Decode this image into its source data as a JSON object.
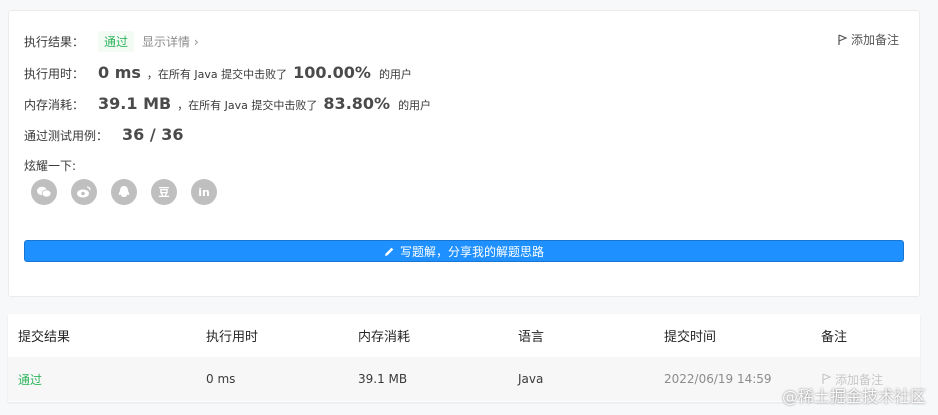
{
  "result": {
    "label": "执行结果：",
    "status": "通过",
    "detail": "显示详情 ›",
    "add_note": "添加备注"
  },
  "runtime": {
    "label": "执行用时：",
    "value": "0 ms",
    "mid": "，在所有 Java 提交中击败了",
    "percent": "100.00%",
    "suffix": "的用户"
  },
  "memory": {
    "label": "内存消耗：",
    "value": "39.1 MB",
    "mid": "，在所有 Java 提交中击败了",
    "percent": "83.80%",
    "suffix": "的用户"
  },
  "tests": {
    "label": "通过测试用例：",
    "value": "36 / 36"
  },
  "share": {
    "label": "炫耀一下:",
    "icons": [
      "wechat-icon",
      "weibo-icon",
      "qq-icon",
      "douban-icon",
      "linkedin-icon"
    ],
    "douban_text": "豆",
    "linkedin_text": "in"
  },
  "write_button": "写题解，分享我的解题思路",
  "table": {
    "headers": [
      "提交结果",
      "执行用时",
      "内存消耗",
      "语言",
      "提交时间",
      "备注"
    ],
    "row": {
      "result": "通过",
      "runtime": "0 ms",
      "memory": "39.1 MB",
      "language": "Java",
      "time": "2022/06/19 14:59",
      "note": "添加备注"
    }
  },
  "watermark": "@稀土掘金技术社区",
  "colors": {
    "accent": "#1e90ff",
    "pass": "#2db55d",
    "icon_gray": "#bfbfbf"
  }
}
